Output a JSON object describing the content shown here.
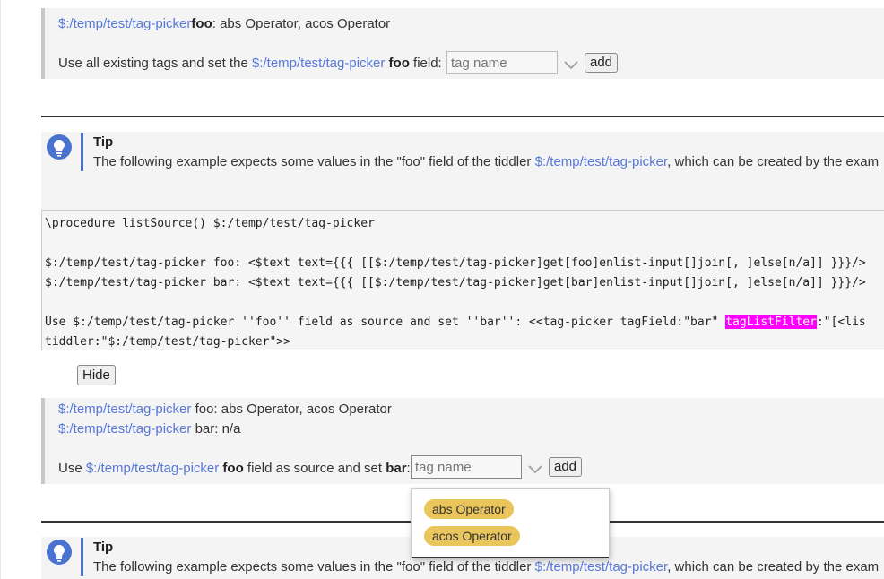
{
  "top_block": {
    "result_link": "$:/temp/test/tag-picker",
    "result_field": "foo",
    "result_value": ": abs Operator, acos Operator",
    "use_prefix": "Use all existing tags and set the ",
    "use_link": "$:/temp/test/tag-picker",
    "use_field": "foo",
    "use_suffix": " field:",
    "input_placeholder": "tag name",
    "add_label": "add"
  },
  "tip1": {
    "title": "Tip",
    "text_prefix": "The following example expects some values in the \"foo\" field of the tiddler ",
    "link": "$:/temp/test/tag-picker",
    "text_suffix": ", which can be created by the exam"
  },
  "code": {
    "line1": "\\procedure listSource() $:/temp/test/tag-picker",
    "line2": "$:/temp/test/tag-picker foo: <$text text={{{ [[$:/temp/test/tag-picker]get[foo]enlist-input[]join[, ]else[n/a]] }}}/>",
    "line3": "$:/temp/test/tag-picker bar: <$text text={{{ [[$:/temp/test/tag-picker]get[bar]enlist-input[]join[, ]else[n/a]] }}}/>",
    "line4_prefix": "Use $:/temp/test/tag-picker ''foo'' field as source and set ''bar'': <<tag-picker tagField:\"bar\" ",
    "line4_highlight": "tagListFilter",
    "line4_suffix": ":\"[<lis",
    "line5": "tiddler:\"$:/temp/test/tag-picker\">>"
  },
  "hide_label": "Hide",
  "result_block": {
    "foo_link": "$:/temp/test/tag-picker",
    "foo_value": " foo: abs Operator, acos Operator",
    "bar_link": "$:/temp/test/tag-picker",
    "bar_value": " bar: n/a",
    "use_prefix": "Use ",
    "use_link": "$:/temp/test/tag-picker",
    "use_field": "foo",
    "use_mid": " field as source and set ",
    "use_field2": "bar",
    "use_colon": ":",
    "input_placeholder": "tag name",
    "add_label": "add"
  },
  "dropdown": {
    "items": [
      "abs Operator",
      "acos Operator"
    ]
  },
  "tip2": {
    "title": "Tip",
    "text_prefix": "The following example expects some values in the \"fo",
    "text_hidden": "o\" field of the tiddler ",
    "link": "$:/temp/test/tag-picker",
    "text_suffix": ", which can be created by the exam"
  },
  "colors": {
    "link": "#5778d8",
    "tip_accent": "#4a72cf",
    "pill": "#e9c55c",
    "highlight": "#ff00ff"
  },
  "icons": [
    "lightbulb-icon",
    "chevron-down-icon"
  ]
}
